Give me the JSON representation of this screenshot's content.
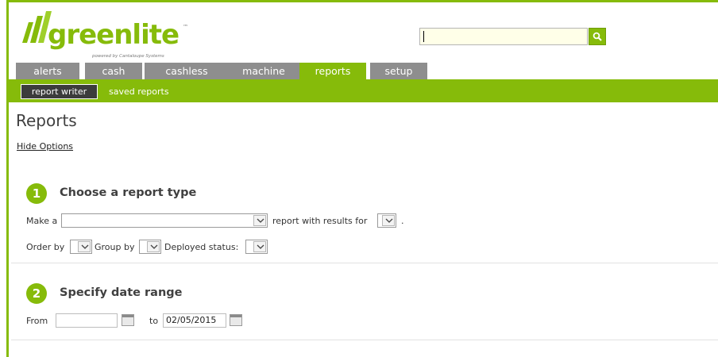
{
  "header": {
    "logo_text": "greenlite",
    "logo_tm": "™",
    "logo_powered": "powered by Cantaloupe Systems",
    "search": {
      "value": "",
      "placeholder": ""
    },
    "search_icon": "magnifier-icon"
  },
  "tabs": [
    {
      "label": "alerts",
      "active": false
    },
    {
      "label": "cash",
      "active": false
    },
    {
      "label": "cashless",
      "active": false
    },
    {
      "label": "machine",
      "active": false
    },
    {
      "label": "reports",
      "active": true
    },
    {
      "label": "setup",
      "active": false
    }
  ],
  "subnav": {
    "active_label": "report writer",
    "link_label": "saved reports"
  },
  "page": {
    "title": "Reports",
    "hide_options": "Hide Options"
  },
  "step1": {
    "number": "1",
    "title": "Choose a report type",
    "make_a_label": "Make a",
    "report_type_value": "",
    "results_label": "report with results for",
    "results_value": "",
    "period": ".",
    "order_by_label": "Order by",
    "order_by_value": "",
    "group_by_label": "Group by",
    "group_by_value": "",
    "deployed_status_label": "Deployed status:",
    "deployed_status_value": ""
  },
  "step2": {
    "number": "2",
    "title": "Specify date range",
    "from_label": "From",
    "from_value": "",
    "to_label": "to",
    "to_value": "02/05/2015"
  },
  "colors": {
    "brand_green": "#86bb0a",
    "tab_gray": "#8e8e8e",
    "subnav_active": "#3c3c3c"
  }
}
